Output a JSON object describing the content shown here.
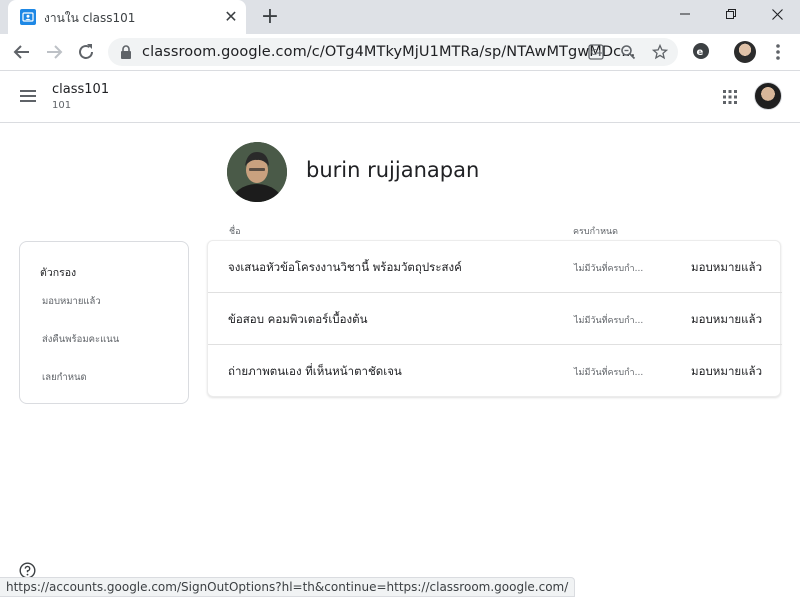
{
  "browser": {
    "tab_title": "งานใน class101",
    "new_tab_label": "+",
    "url": "classroom.google.com/c/OTg4MTkyMjU1MTRa/sp/NTAwMTgwMDc...",
    "status_url": "https://accounts.google.com/SignOutOptions?hl=th&continue=https://classroom.google.com/",
    "favicon_color": "#1e88e5"
  },
  "header": {
    "class_name": "class101",
    "class_section": "101"
  },
  "student": {
    "name": "burin rujjanapan"
  },
  "columns": {
    "name": "ชื่อ",
    "due": "ครบกำหนด"
  },
  "filter": {
    "title": "ตัวกรอง",
    "items": [
      {
        "label": "มอบหมายแล้ว"
      },
      {
        "label": "ส่งคืนพร้อมคะแนน"
      },
      {
        "label": "เลยกำหนด"
      }
    ]
  },
  "assignments": [
    {
      "title": "จงเสนอหัวข้อโครงงานวิชานี้ พร้อมวัตถุประสงค์",
      "due": "ไม่มีวันที่ครบกำ...",
      "status": "มอบหมายแล้ว"
    },
    {
      "title": "ข้อสอบ คอมพิวเตอร์เบื้องต้น",
      "due": "ไม่มีวันที่ครบกำ...",
      "status": "มอบหมายแล้ว"
    },
    {
      "title": "ถ่ายภาพตนเอง ที่เห็นหน้าตาชัดเจน",
      "due": "ไม่มีวันที่ครบกำ...",
      "status": "มอบหมายแล้ว"
    }
  ],
  "icons": {
    "tab": "classroom-favicon-icon",
    "lock": "lock-icon",
    "translate": "translate-icon",
    "zoom": "zoom-icon",
    "star": "star-icon",
    "extension": "extension-icon",
    "apps": "apps-grid-icon",
    "menu": "hamburger-icon",
    "help": "help-icon"
  }
}
